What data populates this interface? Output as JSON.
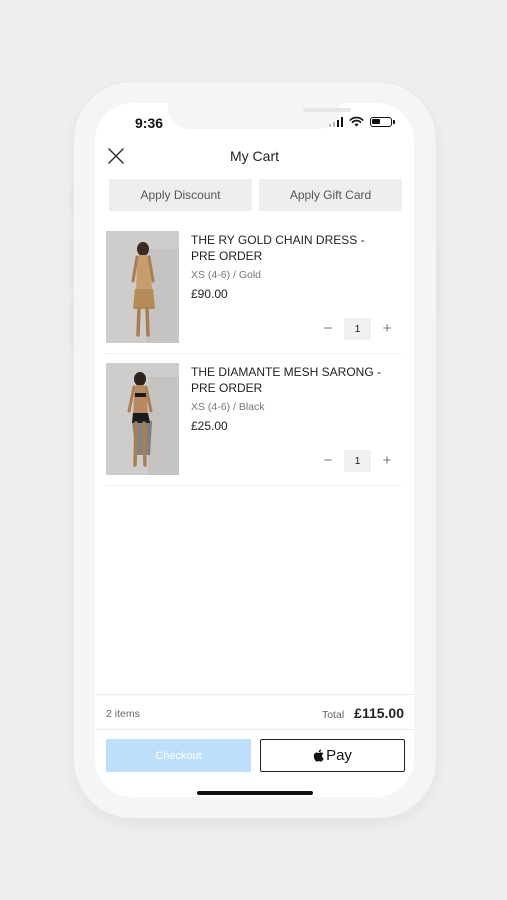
{
  "status_bar": {
    "time": "9:36"
  },
  "header": {
    "title": "My Cart",
    "close_icon": "close-icon"
  },
  "actions": {
    "discount_label": "Apply Discount",
    "gift_card_label": "Apply Gift Card"
  },
  "cart": {
    "items": [
      {
        "name": "THE RY GOLD CHAIN DRESS - PRE ORDER",
        "variant": "XS (4-6) / Gold",
        "price": "£90.00",
        "quantity": "1",
        "decrement": "−",
        "increment": "+"
      },
      {
        "name": "THE DIAMANTE MESH SARONG - PRE ORDER",
        "variant": "XS (4-6) / Black",
        "price": "£25.00",
        "quantity": "1",
        "decrement": "−",
        "increment": "+"
      }
    ]
  },
  "summary": {
    "items_count": "2 items",
    "total_label": "Total",
    "total_value": "£115.00"
  },
  "buttons": {
    "checkout_label": "Checkout",
    "apple_pay_label": "Pay"
  },
  "colors": {
    "checkout_bg": "#bddff9",
    "background": "#efefef"
  }
}
